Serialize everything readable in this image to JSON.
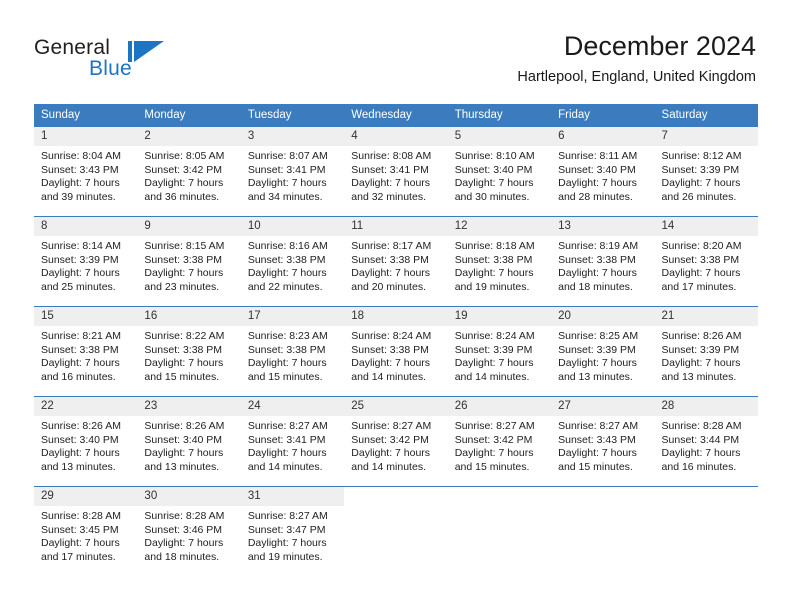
{
  "brand": {
    "word_one": "General",
    "word_two": "Blue",
    "flag_icon": "triangle-flag-icon"
  },
  "header": {
    "title": "December 2024",
    "subtitle": "Hartlepool, England, United Kingdom"
  },
  "colors": {
    "header_blue": "#3a7cbe",
    "brand_blue": "#1c74c4",
    "daynum_bg": "#efefef",
    "text": "#222222"
  },
  "weekdays": [
    "Sunday",
    "Monday",
    "Tuesday",
    "Wednesday",
    "Thursday",
    "Friday",
    "Saturday"
  ],
  "weeks": [
    [
      {
        "day": "1",
        "sunrise": "Sunrise: 8:04 AM",
        "sunset": "Sunset: 3:43 PM",
        "daylight_line1": "Daylight: 7 hours",
        "daylight_line2": "and 39 minutes."
      },
      {
        "day": "2",
        "sunrise": "Sunrise: 8:05 AM",
        "sunset": "Sunset: 3:42 PM",
        "daylight_line1": "Daylight: 7 hours",
        "daylight_line2": "and 36 minutes."
      },
      {
        "day": "3",
        "sunrise": "Sunrise: 8:07 AM",
        "sunset": "Sunset: 3:41 PM",
        "daylight_line1": "Daylight: 7 hours",
        "daylight_line2": "and 34 minutes."
      },
      {
        "day": "4",
        "sunrise": "Sunrise: 8:08 AM",
        "sunset": "Sunset: 3:41 PM",
        "daylight_line1": "Daylight: 7 hours",
        "daylight_line2": "and 32 minutes."
      },
      {
        "day": "5",
        "sunrise": "Sunrise: 8:10 AM",
        "sunset": "Sunset: 3:40 PM",
        "daylight_line1": "Daylight: 7 hours",
        "daylight_line2": "and 30 minutes."
      },
      {
        "day": "6",
        "sunrise": "Sunrise: 8:11 AM",
        "sunset": "Sunset: 3:40 PM",
        "daylight_line1": "Daylight: 7 hours",
        "daylight_line2": "and 28 minutes."
      },
      {
        "day": "7",
        "sunrise": "Sunrise: 8:12 AM",
        "sunset": "Sunset: 3:39 PM",
        "daylight_line1": "Daylight: 7 hours",
        "daylight_line2": "and 26 minutes."
      }
    ],
    [
      {
        "day": "8",
        "sunrise": "Sunrise: 8:14 AM",
        "sunset": "Sunset: 3:39 PM",
        "daylight_line1": "Daylight: 7 hours",
        "daylight_line2": "and 25 minutes."
      },
      {
        "day": "9",
        "sunrise": "Sunrise: 8:15 AM",
        "sunset": "Sunset: 3:38 PM",
        "daylight_line1": "Daylight: 7 hours",
        "daylight_line2": "and 23 minutes."
      },
      {
        "day": "10",
        "sunrise": "Sunrise: 8:16 AM",
        "sunset": "Sunset: 3:38 PM",
        "daylight_line1": "Daylight: 7 hours",
        "daylight_line2": "and 22 minutes."
      },
      {
        "day": "11",
        "sunrise": "Sunrise: 8:17 AM",
        "sunset": "Sunset: 3:38 PM",
        "daylight_line1": "Daylight: 7 hours",
        "daylight_line2": "and 20 minutes."
      },
      {
        "day": "12",
        "sunrise": "Sunrise: 8:18 AM",
        "sunset": "Sunset: 3:38 PM",
        "daylight_line1": "Daylight: 7 hours",
        "daylight_line2": "and 19 minutes."
      },
      {
        "day": "13",
        "sunrise": "Sunrise: 8:19 AM",
        "sunset": "Sunset: 3:38 PM",
        "daylight_line1": "Daylight: 7 hours",
        "daylight_line2": "and 18 minutes."
      },
      {
        "day": "14",
        "sunrise": "Sunrise: 8:20 AM",
        "sunset": "Sunset: 3:38 PM",
        "daylight_line1": "Daylight: 7 hours",
        "daylight_line2": "and 17 minutes."
      }
    ],
    [
      {
        "day": "15",
        "sunrise": "Sunrise: 8:21 AM",
        "sunset": "Sunset: 3:38 PM",
        "daylight_line1": "Daylight: 7 hours",
        "daylight_line2": "and 16 minutes."
      },
      {
        "day": "16",
        "sunrise": "Sunrise: 8:22 AM",
        "sunset": "Sunset: 3:38 PM",
        "daylight_line1": "Daylight: 7 hours",
        "daylight_line2": "and 15 minutes."
      },
      {
        "day": "17",
        "sunrise": "Sunrise: 8:23 AM",
        "sunset": "Sunset: 3:38 PM",
        "daylight_line1": "Daylight: 7 hours",
        "daylight_line2": "and 15 minutes."
      },
      {
        "day": "18",
        "sunrise": "Sunrise: 8:24 AM",
        "sunset": "Sunset: 3:38 PM",
        "daylight_line1": "Daylight: 7 hours",
        "daylight_line2": "and 14 minutes."
      },
      {
        "day": "19",
        "sunrise": "Sunrise: 8:24 AM",
        "sunset": "Sunset: 3:39 PM",
        "daylight_line1": "Daylight: 7 hours",
        "daylight_line2": "and 14 minutes."
      },
      {
        "day": "20",
        "sunrise": "Sunrise: 8:25 AM",
        "sunset": "Sunset: 3:39 PM",
        "daylight_line1": "Daylight: 7 hours",
        "daylight_line2": "and 13 minutes."
      },
      {
        "day": "21",
        "sunrise": "Sunrise: 8:26 AM",
        "sunset": "Sunset: 3:39 PM",
        "daylight_line1": "Daylight: 7 hours",
        "daylight_line2": "and 13 minutes."
      }
    ],
    [
      {
        "day": "22",
        "sunrise": "Sunrise: 8:26 AM",
        "sunset": "Sunset: 3:40 PM",
        "daylight_line1": "Daylight: 7 hours",
        "daylight_line2": "and 13 minutes."
      },
      {
        "day": "23",
        "sunrise": "Sunrise: 8:26 AM",
        "sunset": "Sunset: 3:40 PM",
        "daylight_line1": "Daylight: 7 hours",
        "daylight_line2": "and 13 minutes."
      },
      {
        "day": "24",
        "sunrise": "Sunrise: 8:27 AM",
        "sunset": "Sunset: 3:41 PM",
        "daylight_line1": "Daylight: 7 hours",
        "daylight_line2": "and 14 minutes."
      },
      {
        "day": "25",
        "sunrise": "Sunrise: 8:27 AM",
        "sunset": "Sunset: 3:42 PM",
        "daylight_line1": "Daylight: 7 hours",
        "daylight_line2": "and 14 minutes."
      },
      {
        "day": "26",
        "sunrise": "Sunrise: 8:27 AM",
        "sunset": "Sunset: 3:42 PM",
        "daylight_line1": "Daylight: 7 hours",
        "daylight_line2": "and 15 minutes."
      },
      {
        "day": "27",
        "sunrise": "Sunrise: 8:27 AM",
        "sunset": "Sunset: 3:43 PM",
        "daylight_line1": "Daylight: 7 hours",
        "daylight_line2": "and 15 minutes."
      },
      {
        "day": "28",
        "sunrise": "Sunrise: 8:28 AM",
        "sunset": "Sunset: 3:44 PM",
        "daylight_line1": "Daylight: 7 hours",
        "daylight_line2": "and 16 minutes."
      }
    ],
    [
      {
        "day": "29",
        "sunrise": "Sunrise: 8:28 AM",
        "sunset": "Sunset: 3:45 PM",
        "daylight_line1": "Daylight: 7 hours",
        "daylight_line2": "and 17 minutes."
      },
      {
        "day": "30",
        "sunrise": "Sunrise: 8:28 AM",
        "sunset": "Sunset: 3:46 PM",
        "daylight_line1": "Daylight: 7 hours",
        "daylight_line2": "and 18 minutes."
      },
      {
        "day": "31",
        "sunrise": "Sunrise: 8:27 AM",
        "sunset": "Sunset: 3:47 PM",
        "daylight_line1": "Daylight: 7 hours",
        "daylight_line2": "and 19 minutes."
      },
      {
        "day": "",
        "sunrise": "",
        "sunset": "",
        "daylight_line1": "",
        "daylight_line2": ""
      },
      {
        "day": "",
        "sunrise": "",
        "sunset": "",
        "daylight_line1": "",
        "daylight_line2": ""
      },
      {
        "day": "",
        "sunrise": "",
        "sunset": "",
        "daylight_line1": "",
        "daylight_line2": ""
      },
      {
        "day": "",
        "sunrise": "",
        "sunset": "",
        "daylight_line1": "",
        "daylight_line2": ""
      }
    ]
  ]
}
